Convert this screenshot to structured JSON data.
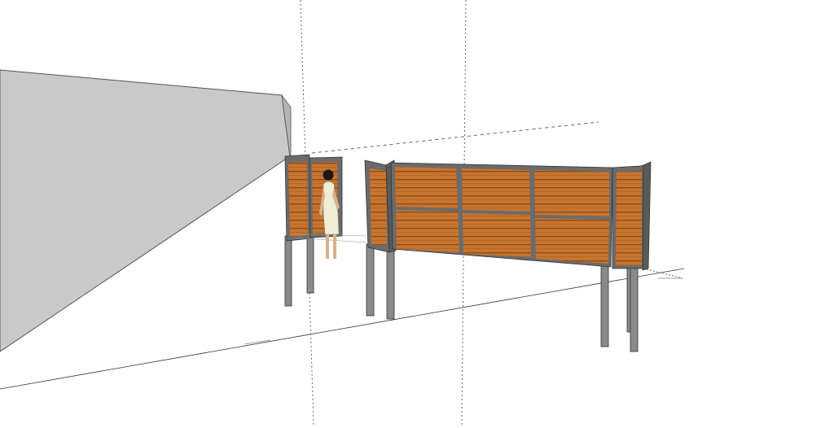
{
  "scene": {
    "kind": "3d-model-viewport",
    "background_color": "#ffffff",
    "wall_color": "#c8c8c8",
    "wood_color": "#c8742e",
    "steel_color": "#7d7d7d",
    "figure_label": "",
    "dimension_note_1": "",
    "dimension_note_2": ""
  }
}
